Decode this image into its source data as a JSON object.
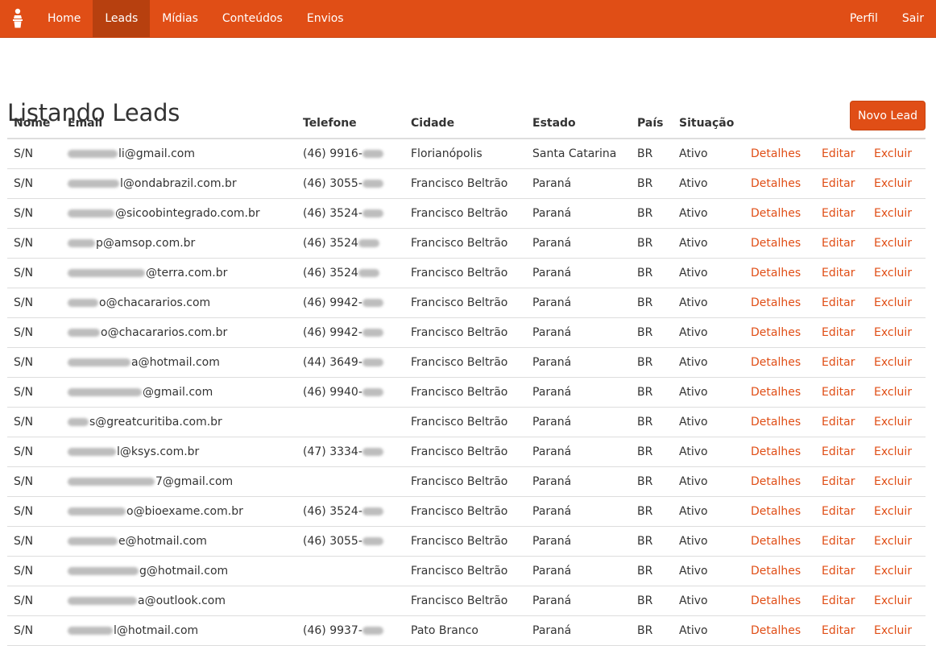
{
  "nav": {
    "brand_icon": "person-podium-icon",
    "items": [
      {
        "label": "Home"
      },
      {
        "label": "Leads",
        "active": true
      },
      {
        "label": "Mídias"
      },
      {
        "label": "Conteúdos"
      },
      {
        "label": "Envios"
      }
    ],
    "right": [
      {
        "label": "Perfil"
      },
      {
        "label": "Sair"
      }
    ]
  },
  "page": {
    "title": "Listando Leads",
    "new_button": "Novo Lead"
  },
  "table": {
    "headers": [
      "Nome",
      "Email",
      "Telefone",
      "Cidade",
      "Estado",
      "País",
      "Situação",
      "",
      "",
      ""
    ],
    "actions": [
      "Detalhes",
      "Editar",
      "Excluir"
    ],
    "rows": [
      {
        "nome": "S/N",
        "email_visible": "li@gmail.com",
        "telefone_visible": "(46) 9916-",
        "cidade": "Florianópolis",
        "estado": "Santa Catarina",
        "pais": "BR",
        "situacao": "Ativo"
      },
      {
        "nome": "S/N",
        "email_visible": "l@ondabrazil.com.br",
        "telefone_visible": "(46) 3055-",
        "cidade": "Francisco Beltrão",
        "estado": "Paraná",
        "pais": "BR",
        "situacao": "Ativo"
      },
      {
        "nome": "S/N",
        "email_visible": "@sicoobintegrado.com.br",
        "telefone_visible": "(46) 3524-",
        "cidade": "Francisco Beltrão",
        "estado": "Paraná",
        "pais": "BR",
        "situacao": "Ativo"
      },
      {
        "nome": "S/N",
        "email_visible": "p@amsop.com.br",
        "telefone_visible": "(46) 3524",
        "cidade": "Francisco Beltrão",
        "estado": "Paraná",
        "pais": "BR",
        "situacao": "Ativo"
      },
      {
        "nome": "S/N",
        "email_visible": "@terra.com.br",
        "telefone_visible": "(46) 3524",
        "cidade": "Francisco Beltrão",
        "estado": "Paraná",
        "pais": "BR",
        "situacao": "Ativo"
      },
      {
        "nome": "S/N",
        "email_visible": "o@chacararios.com",
        "telefone_visible": "(46) 9942-",
        "cidade": "Francisco Beltrão",
        "estado": "Paraná",
        "pais": "BR",
        "situacao": "Ativo"
      },
      {
        "nome": "S/N",
        "email_visible": "o@chacararios.com.br",
        "telefone_visible": "(46) 9942-",
        "cidade": "Francisco Beltrão",
        "estado": "Paraná",
        "pais": "BR",
        "situacao": "Ativo"
      },
      {
        "nome": "S/N",
        "email_visible": "a@hotmail.com",
        "telefone_visible": "(44) 3649-",
        "cidade": "Francisco Beltrão",
        "estado": "Paraná",
        "pais": "BR",
        "situacao": "Ativo"
      },
      {
        "nome": "S/N",
        "email_visible": "@gmail.com",
        "telefone_visible": "(46) 9940-",
        "cidade": "Francisco Beltrão",
        "estado": "Paraná",
        "pais": "BR",
        "situacao": "Ativo"
      },
      {
        "nome": "S/N",
        "email_visible": "s@greatcuritiba.com.br",
        "telefone_visible": "",
        "cidade": "Francisco Beltrão",
        "estado": "Paraná",
        "pais": "BR",
        "situacao": "Ativo"
      },
      {
        "nome": "S/N",
        "email_visible": "l@ksys.com.br",
        "telefone_visible": "(47) 3334-",
        "cidade": "Francisco Beltrão",
        "estado": "Paraná",
        "pais": "BR",
        "situacao": "Ativo"
      },
      {
        "nome": "S/N",
        "email_visible": "7@gmail.com",
        "telefone_visible": "",
        "cidade": "Francisco Beltrão",
        "estado": "Paraná",
        "pais": "BR",
        "situacao": "Ativo"
      },
      {
        "nome": "S/N",
        "email_visible": "o@bioexame.com.br",
        "telefone_visible": "(46) 3524-",
        "cidade": "Francisco Beltrão",
        "estado": "Paraná",
        "pais": "BR",
        "situacao": "Ativo"
      },
      {
        "nome": "S/N",
        "email_visible": "e@hotmail.com",
        "telefone_visible": "(46) 3055-",
        "cidade": "Francisco Beltrão",
        "estado": "Paraná",
        "pais": "BR",
        "situacao": "Ativo"
      },
      {
        "nome": "S/N",
        "email_visible": "g@hotmail.com",
        "telefone_visible": "",
        "cidade": "Francisco Beltrão",
        "estado": "Paraná",
        "pais": "BR",
        "situacao": "Ativo"
      },
      {
        "nome": "S/N",
        "email_visible": "a@outlook.com",
        "telefone_visible": "",
        "cidade": "Francisco Beltrão",
        "estado": "Paraná",
        "pais": "BR",
        "situacao": "Ativo"
      },
      {
        "nome": "S/N",
        "email_visible": "l@hotmail.com",
        "telefone_visible": "(46) 9937-",
        "cidade": "Pato Branco",
        "estado": "Paraná",
        "pais": "BR",
        "situacao": "Ativo"
      }
    ]
  },
  "colors": {
    "accent": "#e04e16",
    "nav_active": "#b7400f",
    "text": "#333333",
    "border": "#dddddd"
  }
}
